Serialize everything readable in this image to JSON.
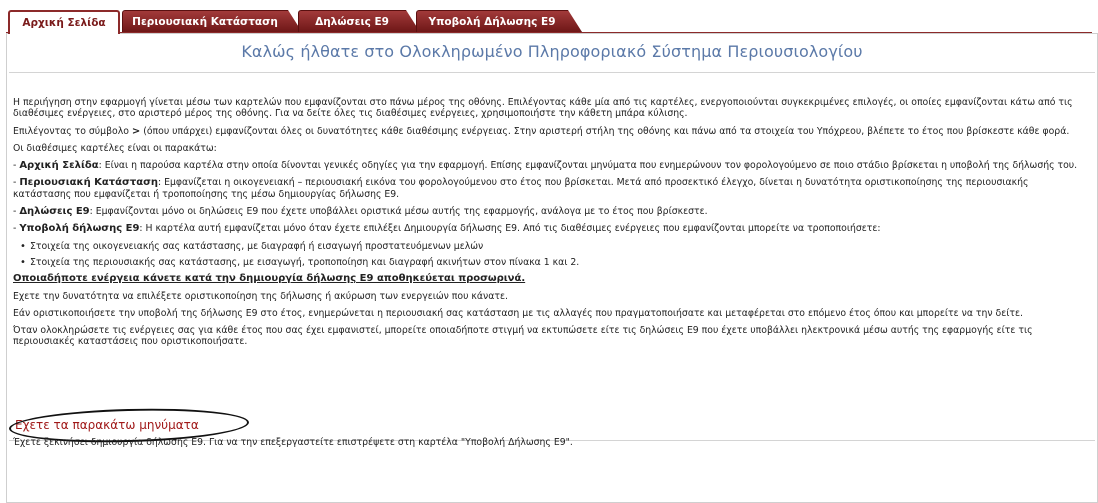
{
  "tabs": [
    {
      "label": "Αρχική Σελίδα",
      "active": true
    },
    {
      "label": "Περιουσιακή Κατάσταση",
      "active": false
    },
    {
      "label": "Δηλώσεις Ε9",
      "active": false
    },
    {
      "label": "Υποβολή Δήλωσης Ε9",
      "active": false
    }
  ],
  "colors": {
    "tab_active_text": "#7a1a1a",
    "tab_bg": "#8c2a2a",
    "title": "#5b79a8",
    "messages_header": "#a01818"
  },
  "welcome_title": "Καλώς ήλθατε στο Ολοκληρωμένο Πληροφοριακό Σύστημα Περιουσιολογίου",
  "intro": {
    "p1": "Η περιήγηση στην εφαρμογή γίνεται μέσω των καρτελών που εμφανίζονται στο πάνω μέρος της οθόνης. Επιλέγοντας κάθε μία από τις καρτέλες, ενεργοποιούνται συγκεκριμένες επιλογές, οι οποίες εμφανίζονται κάτω από τις διαθέσιμες ενέργειες, στο αριστερό μέρος της οθόνης. Για να δείτε όλες τις διαθέσιμες ενέργειες, χρησιμοποιήστε την κάθετη μπάρα κύλισης.",
    "p2_before": "Επιλέγοντας το σύμβολο",
    "p2_symbol": ">",
    "p2_after": "(όπου υπάρχει) εμφανίζονται όλες οι δυνατότητες κάθε διαθέσιμης ενέργειας. Στην αριστερή στήλη της οθόνης και πάνω από τα στοιχεία του Υπόχρεου, βλέπετε το έτος που βρίσκεστε κάθε φορά.",
    "p3": "Οι διαθέσιμες καρτέλες είναι οι παρακάτω:"
  },
  "tab_descriptions": [
    {
      "name": "Αρχική Σελίδα",
      "text": ": Είναι η παρούσα καρτέλα στην οποία δίνονται γενικές οδηγίες για την εφαρμογή. Επίσης εμφανίζονται μηνύματα που ενημερώνουν τον φορολογούμενο σε ποιο στάδιο βρίσκεται η υποβολή της δήλωσής του."
    },
    {
      "name": "Περιουσιακή Κατάσταση",
      "text": ": Εμφανίζεται η οικογενειακή – περιουσιακή εικόνα του φορολογούμενου στο έτος που βρίσκεται. Μετά από προσεκτικό έλεγχο, δίνεται η δυνατότητα οριστικοποίησης της περιουσιακής κατάστασης που εμφανίζεται ή τροποποίησης της μέσω δημιουργίας δήλωσης Ε9."
    },
    {
      "name": "Δηλώσεις Ε9",
      "text": ": Εμφανίζονται μόνο οι δηλώσεις Ε9 που έχετε υποβάλλει οριστικά μέσω αυτής της εφαρμογής, ανάλογα με το έτος που βρίσκεστε."
    },
    {
      "name": "Υποβολή δήλωσης Ε9",
      "text": ": Η καρτέλα αυτή εμφανίζεται μόνο όταν έχετε επιλέξει Δημιουργία δήλωσης Ε9. Από τις διαθέσιμες ενέργειες που εμφανίζονται μπορείτε να τροποποιήσετε:"
    }
  ],
  "bullets": [
    "Στοιχεία της οικογενειακής σας κατάστασης, με διαγραφή ή εισαγωγή προστατευόμενων μελών",
    "Στοιχεία της περιουσιακής σας κατάστασης, με εισαγωγή, τροποποίηση και διαγραφή ακινήτων στον πίνακα 1 και 2."
  ],
  "warning": "Οποιαδήποτε ενέργεια κάνετε κατά την δημιουργία δήλωσης Ε9 αποθηκεύεται προσωρινά.",
  "after": {
    "p1": "Εχετε την δυνατότητα να επιλέξετε οριστικοποίηση της δήλωσης ή ακύρωση των ενεργειών που κάνατε.",
    "p2": "Εάν οριστικοποιήσετε την υποβολή της δήλωσης Ε9 στο έτος, ενημερώνεται η περιουσιακή σας κατάσταση με τις αλλαγές που πραγματοποιήσατε και μεταφέρεται στο επόμενο έτος όπου και μπορείτε να την δείτε.",
    "p3": "Όταν ολοκληρώσετε τις ενέργειες σας για κάθε έτος που σας έχει εμφανιστεί, μπορείτε οποιαδήποτε στιγμή να εκτυπώσετε είτε τις δηλώσεις Ε9 που έχετε υποβάλλει ηλεκτρονικά μέσω αυτής της εφαρμογής είτε τις περιουσιακές καταστάσεις που οριστικοποιήσατε."
  },
  "messages": {
    "header": "Εχετε τα παρακάτω μηνύματα",
    "text": "Έχετε ξεκινήσει δημιουργία δήλωσης Ε9. Για να την επεξεργαστείτε επιστρέψετε στη καρτέλα \"Υποβολή Δήλωσης Ε9\"."
  }
}
